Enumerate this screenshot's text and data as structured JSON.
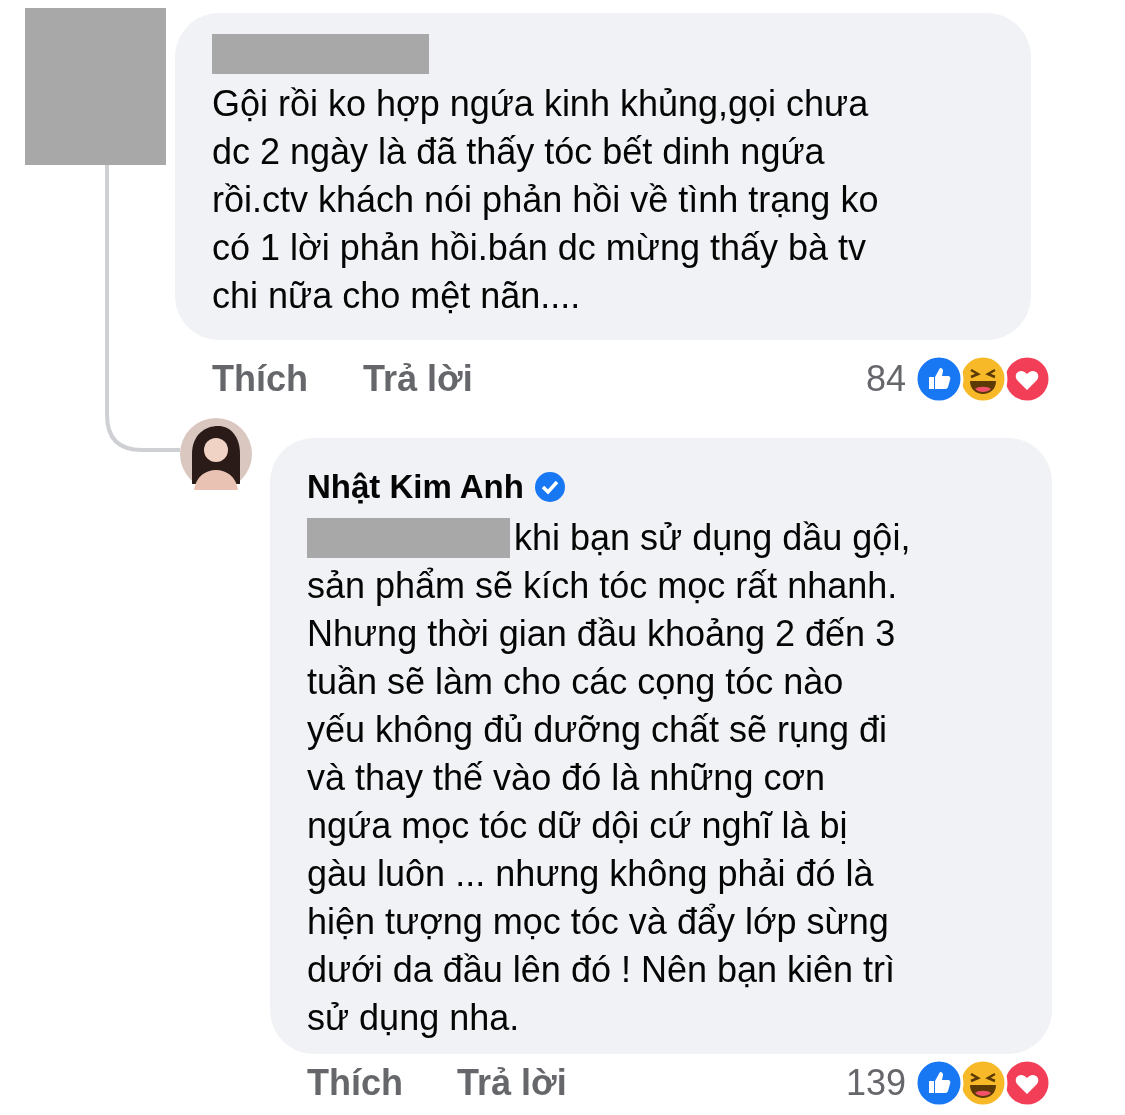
{
  "comments": [
    {
      "author_hidden": true,
      "lines": [
        "Gội rồi ko hợp ngứa kinh khủng,gọi chưa",
        "dc 2 ngày là đã thấy tóc bết dinh ngứa",
        "rồi.ctv khách nói phản hồi về tình trạng ko",
        "có 1 lời phản hồi.bán dc mừng thấy bà tv",
        "chi nữa cho mệt nãn...."
      ],
      "actions": [
        "Thích",
        "Trả lời"
      ],
      "reaction_count": "84"
    },
    {
      "author": "Nhật Kim Anh",
      "verified": true,
      "first_line": "khi bạn sử dụng dầu gội,",
      "lines": [
        "sản phẩm sẽ kích tóc mọc rất nhanh.",
        "Nhưng thời gian đầu khoảng 2 đến 3",
        "tuần sẽ làm cho các cọng tóc nào",
        "yếu không đủ dưỡng chất sẽ rụng đi",
        "và thay thế vào đó là những cơn",
        "ngứa mọc tóc dữ dội cứ nghĩ là bị",
        "gàu luôn ... nhưng không phải đó là",
        "hiện tượng mọc tóc và đẩy lớp sừng",
        "dưới da đầu lên đó ! Nên bạn kiên trì",
        "sử dụng nha."
      ],
      "actions": [
        "Thích",
        "Trả lời"
      ],
      "reaction_count": "139"
    }
  ]
}
